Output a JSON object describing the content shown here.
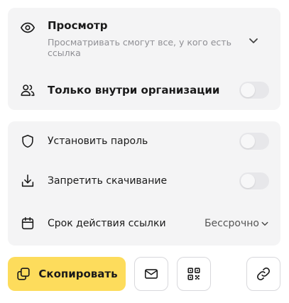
{
  "access": {
    "title": "Просмотр",
    "subtitle": "Просматривать смогут все, у кого есть ссылка",
    "org_only_label": "Только внутри организации",
    "org_only_enabled": false
  },
  "settings": {
    "password_label": "Установить пароль",
    "password_enabled": false,
    "no_download_label": "Запретить скачивание",
    "no_download_enabled": false,
    "expiry_label": "Срок действия ссылки",
    "expiry_value": "Бессрочно"
  },
  "actions": {
    "copy_label": "Скопировать"
  },
  "icons": {
    "view": "eye-icon",
    "org": "users-icon",
    "password": "shield-icon",
    "download": "download-icon",
    "expiry": "calendar-icon",
    "copy": "copy-icon",
    "mail": "mail-icon",
    "qr": "qr-code-icon",
    "link": "link-icon"
  },
  "colors": {
    "primary_button": "#fddc5c",
    "card_bg": "#f4f4f5",
    "toggle_off": "#e7e7ea"
  }
}
